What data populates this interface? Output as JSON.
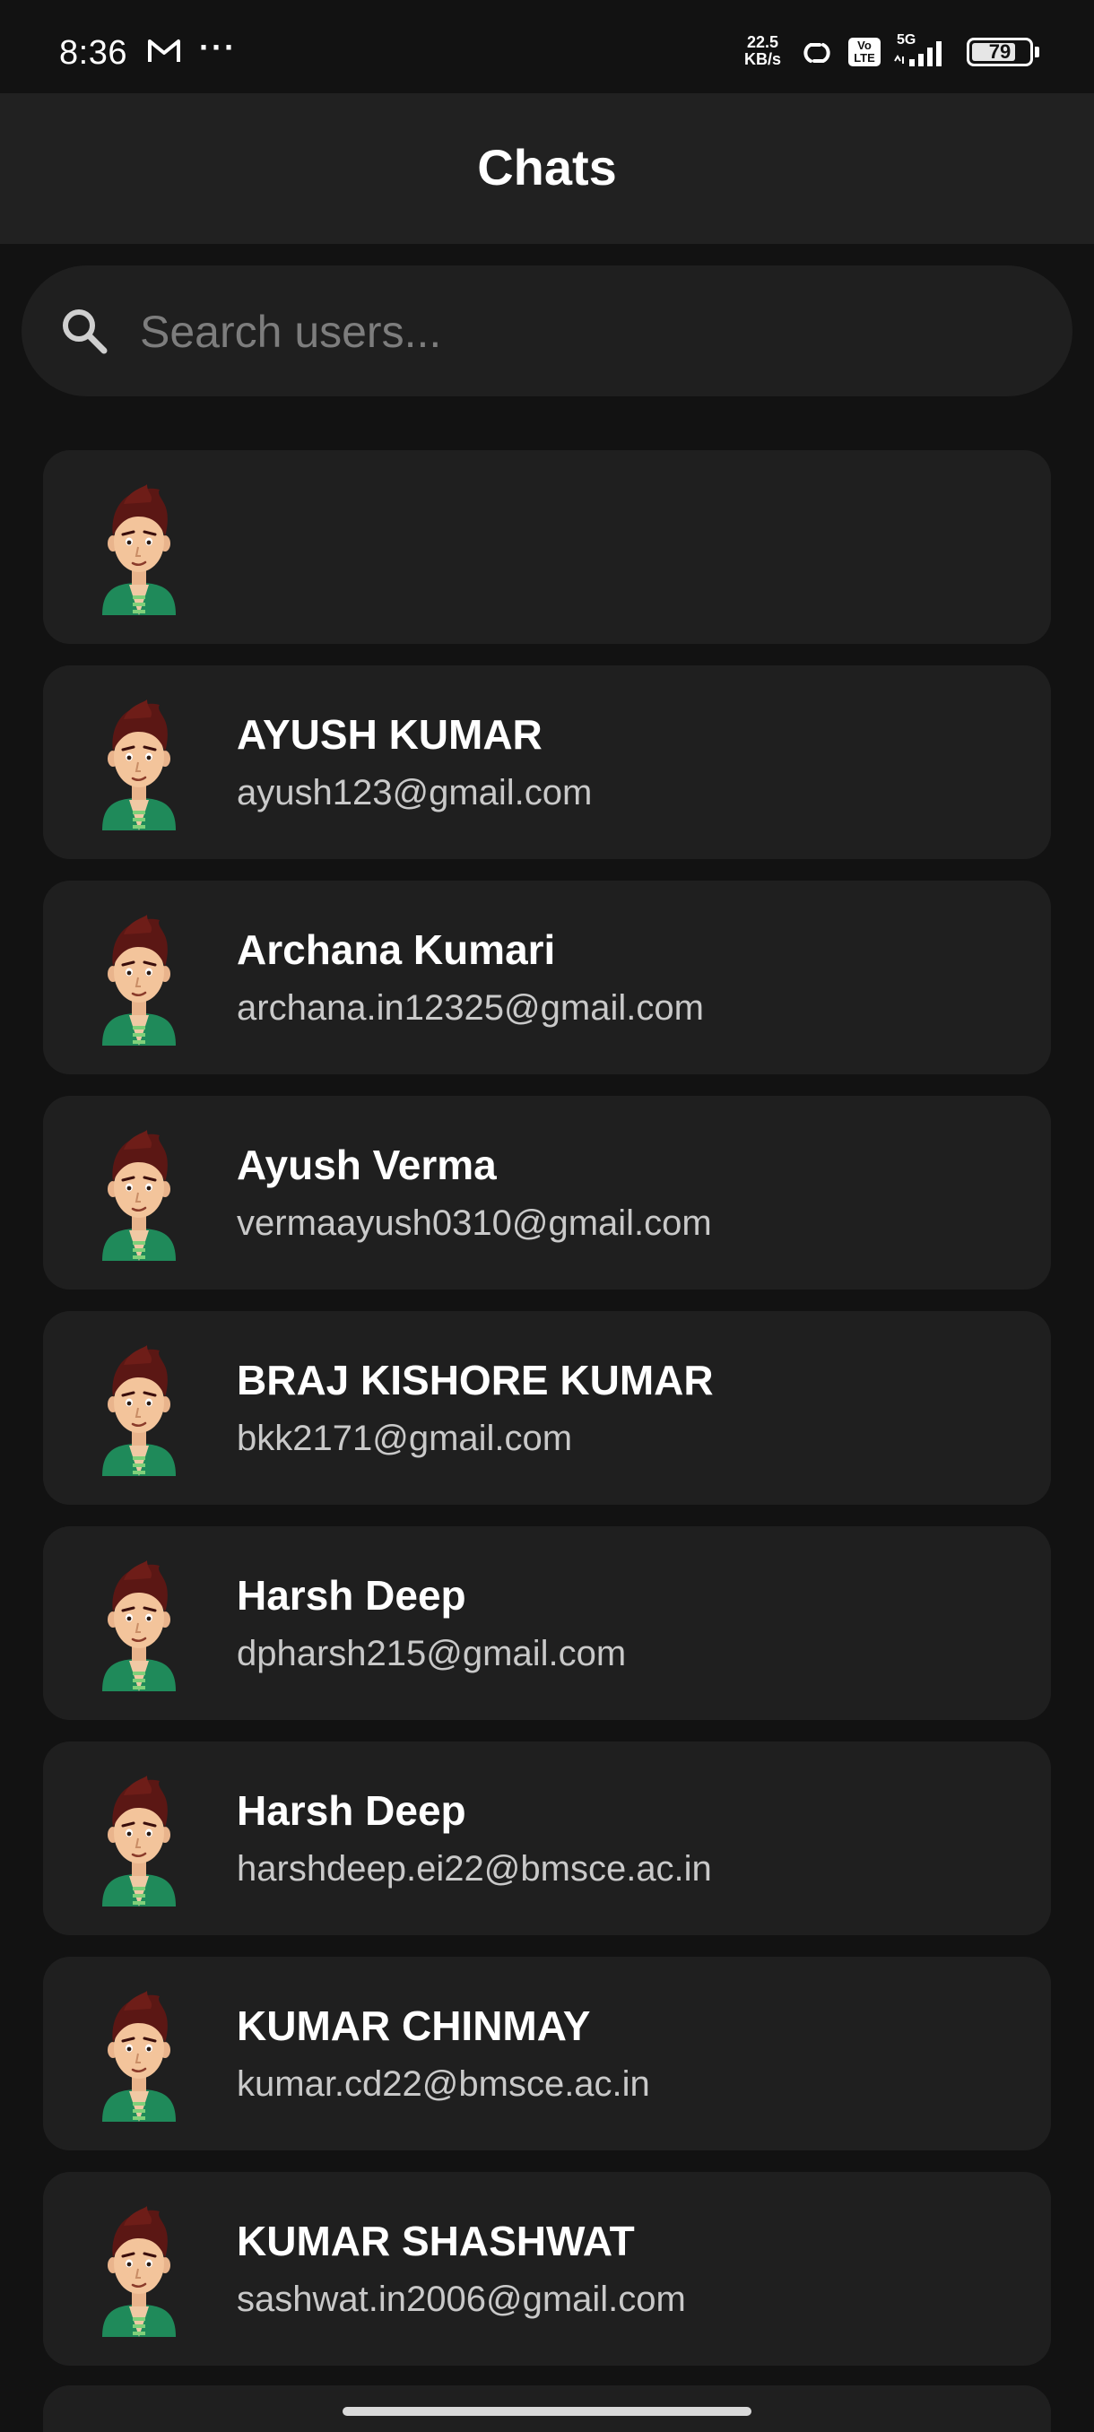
{
  "status_bar": {
    "time": "8:36",
    "speed_value": "22.5",
    "speed_unit": "KB/s",
    "network": "5G",
    "volte": "Vo\nLTE",
    "battery": "79",
    "battery_percent": 79
  },
  "header": {
    "title": "Chats"
  },
  "search": {
    "placeholder": "Search users...",
    "value": ""
  },
  "users": [
    {
      "name": "",
      "email": ""
    },
    {
      "name": "AYUSH KUMAR",
      "email": "ayush123@gmail.com"
    },
    {
      "name": "Archana Kumari",
      "email": "archana.in12325@gmail.com"
    },
    {
      "name": "Ayush Verma",
      "email": "vermaayush0310@gmail.com"
    },
    {
      "name": "BRAJ KISHORE KUMAR",
      "email": "bkk2171@gmail.com"
    },
    {
      "name": "Harsh Deep",
      "email": "dpharsh215@gmail.com"
    },
    {
      "name": "Harsh Deep",
      "email": "harshdeep.ei22@bmsce.ac.in"
    },
    {
      "name": "KUMAR CHINMAY",
      "email": "kumar.cd22@bmsce.ac.in"
    },
    {
      "name": "KUMAR SHASHWAT",
      "email": "sashwat.in2006@gmail.com"
    }
  ],
  "colors": {
    "background": "#121212",
    "header": "#212121",
    "card": "#1f1f1f",
    "primary_text": "#ffffff",
    "secondary_text": "#c9c9c9"
  }
}
